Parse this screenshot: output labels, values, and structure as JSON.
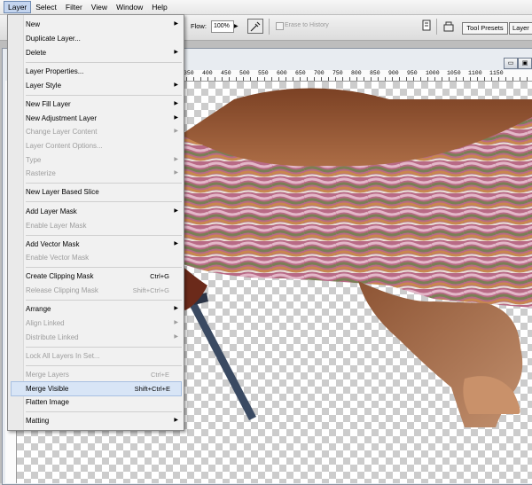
{
  "menubar": {
    "items": [
      "Layer",
      "Select",
      "Filter",
      "View",
      "Window",
      "Help"
    ]
  },
  "options": {
    "flow_label": "Flow:",
    "flow_value": "100%",
    "erase_to_history": "Erase to History",
    "tool_presets_tab": "Tool Presets",
    "layers_tab": "Layer"
  },
  "ruler": {
    "ticks": [
      "350",
      "400",
      "450",
      "500",
      "550",
      "600",
      "650",
      "700",
      "750",
      "800",
      "850",
      "900",
      "950",
      "1000",
      "1050",
      "1100",
      "1150"
    ]
  },
  "layer_menu": {
    "items": [
      {
        "label": "New",
        "shortcut": "",
        "submenu": true,
        "disabled": false
      },
      {
        "label": "Duplicate Layer...",
        "shortcut": "",
        "submenu": false,
        "disabled": false
      },
      {
        "label": "Delete",
        "shortcut": "",
        "submenu": true,
        "disabled": false
      },
      {
        "label": "Layer Properties...",
        "shortcut": "",
        "submenu": false,
        "disabled": false
      },
      {
        "label": "Layer Style",
        "shortcut": "",
        "submenu": true,
        "disabled": false
      },
      {
        "label": "New Fill Layer",
        "shortcut": "",
        "submenu": true,
        "disabled": false
      },
      {
        "label": "New Adjustment Layer",
        "shortcut": "",
        "submenu": true,
        "disabled": false
      },
      {
        "label": "Change Layer Content",
        "shortcut": "",
        "submenu": true,
        "disabled": true
      },
      {
        "label": "Layer Content Options...",
        "shortcut": "",
        "submenu": false,
        "disabled": true
      },
      {
        "label": "Type",
        "shortcut": "",
        "submenu": true,
        "disabled": true
      },
      {
        "label": "Rasterize",
        "shortcut": "",
        "submenu": true,
        "disabled": true
      },
      {
        "label": "New Layer Based Slice",
        "shortcut": "",
        "submenu": false,
        "disabled": false
      },
      {
        "label": "Add Layer Mask",
        "shortcut": "",
        "submenu": true,
        "disabled": false
      },
      {
        "label": "Enable Layer Mask",
        "shortcut": "",
        "submenu": false,
        "disabled": true
      },
      {
        "label": "Add Vector Mask",
        "shortcut": "",
        "submenu": true,
        "disabled": false
      },
      {
        "label": "Enable Vector Mask",
        "shortcut": "",
        "submenu": false,
        "disabled": true
      },
      {
        "label": "Create Clipping Mask",
        "shortcut": "Ctrl+G",
        "submenu": false,
        "disabled": false
      },
      {
        "label": "Release Clipping Mask",
        "shortcut": "Shift+Ctrl+G",
        "submenu": false,
        "disabled": true
      },
      {
        "label": "Arrange",
        "shortcut": "",
        "submenu": true,
        "disabled": false
      },
      {
        "label": "Align Linked",
        "shortcut": "",
        "submenu": true,
        "disabled": true
      },
      {
        "label": "Distribute Linked",
        "shortcut": "",
        "submenu": true,
        "disabled": true
      },
      {
        "label": "Lock All Layers In Set...",
        "shortcut": "",
        "submenu": false,
        "disabled": true
      },
      {
        "label": "Merge Layers",
        "shortcut": "Ctrl+E",
        "submenu": false,
        "disabled": true
      },
      {
        "label": "Merge Visible",
        "shortcut": "Shift+Ctrl+E",
        "submenu": false,
        "disabled": false,
        "highlighted": true
      },
      {
        "label": "Flatten Image",
        "shortcut": "",
        "submenu": false,
        "disabled": false
      },
      {
        "label": "Matting",
        "shortcut": "",
        "submenu": true,
        "disabled": false
      }
    ]
  }
}
